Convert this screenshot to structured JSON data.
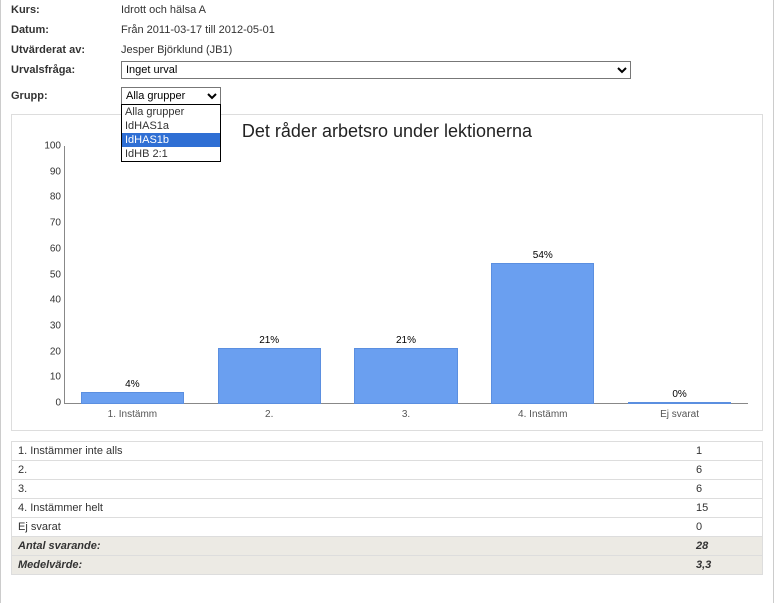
{
  "meta": {
    "kurs_label": "Kurs:",
    "kurs_value": "Idrott och hälsa A",
    "datum_label": "Datum:",
    "datum_value": "Från 2011-03-17 till 2012-05-01",
    "utv_label": "Utvärderat av:",
    "utv_value": "Jesper Björklund (JB1)",
    "urval_label": "Urvalsfråga:",
    "urval_select": "Inget urval",
    "grupp_label": "Grupp:",
    "grupp_select": "Alla grupper",
    "grupp_options": [
      "Alla grupper",
      "IdHAS1a",
      "IdHAS1b",
      "IdHB 2:1"
    ],
    "grupp_selected_index": 2
  },
  "chart_data": {
    "type": "bar",
    "title": "Det råder arbetsro under lektionerna",
    "categories": [
      "1. Instämm",
      "2.",
      "3.",
      "4. Instämm",
      "Ej svarat"
    ],
    "values": [
      4,
      21,
      21,
      54,
      0
    ],
    "value_labels": [
      "4%",
      "21%",
      "21%",
      "54%",
      "0%"
    ],
    "ylabel": "",
    "xlabel": "",
    "ylim": [
      0,
      100
    ],
    "yticks": [
      0,
      10,
      20,
      30,
      40,
      50,
      60,
      70,
      80,
      90,
      100
    ]
  },
  "results": {
    "rows": [
      {
        "label": "1. Instämmer inte alls",
        "value": "1"
      },
      {
        "label": "2.",
        "value": "6"
      },
      {
        "label": "3.",
        "value": "6"
      },
      {
        "label": "4. Instämmer helt",
        "value": "15"
      },
      {
        "label": "Ej svarat",
        "value": "0"
      }
    ],
    "summary": [
      {
        "label": "Antal svarande:",
        "value": "28"
      },
      {
        "label": "Medelvärde:",
        "value": "3,3"
      }
    ]
  }
}
